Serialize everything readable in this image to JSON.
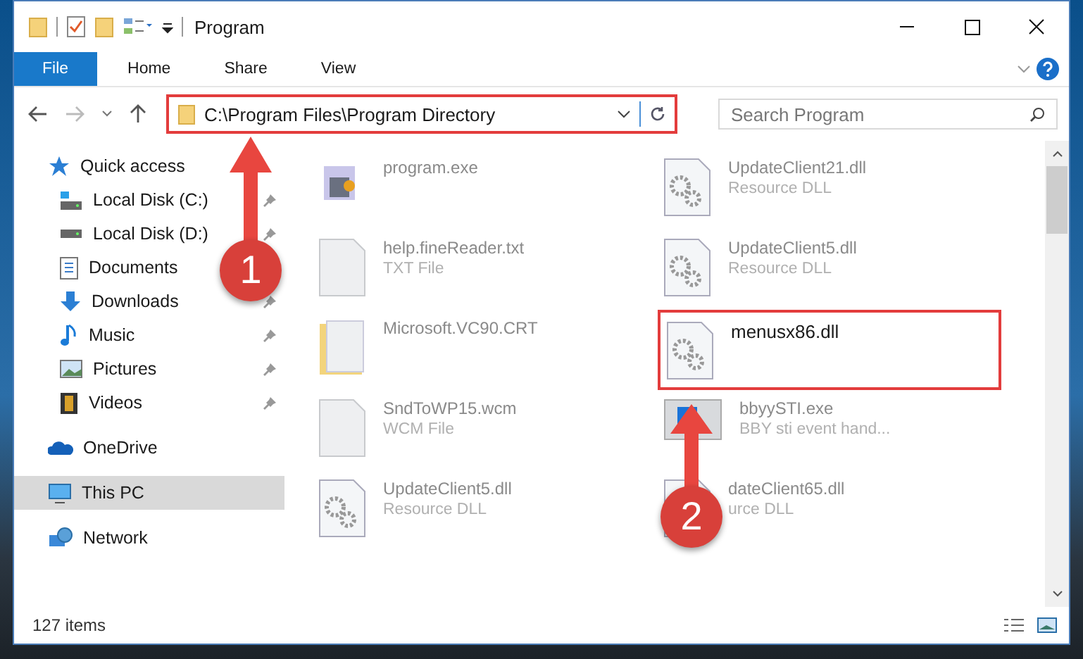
{
  "window": {
    "title": "Program"
  },
  "ribbon_tabs": [
    {
      "label": "File",
      "selected": true
    },
    {
      "label": "Home",
      "selected": false
    },
    {
      "label": "Share",
      "selected": false
    },
    {
      "label": "View",
      "selected": false
    }
  ],
  "address": {
    "path": "C:\\Program Files\\Program Directory",
    "highlighted": true
  },
  "search": {
    "placeholder": "Search Program"
  },
  "sidebar": {
    "items": [
      {
        "label": "Quick access",
        "kind": "star",
        "selected": false,
        "children": [
          {
            "label": "Local Disk (C:)",
            "kind": "disk-c",
            "pinned": true
          },
          {
            "label": "Local Disk (D:)",
            "kind": "disk",
            "pinned": true
          },
          {
            "label": "Documents",
            "kind": "docs"
          },
          {
            "label": "Downloads",
            "kind": "down",
            "pinned": true
          },
          {
            "label": "Music",
            "kind": "music",
            "pinned": true
          },
          {
            "label": "Pictures",
            "kind": "pics",
            "pinned": true
          },
          {
            "label": "Videos",
            "kind": "video",
            "pinned": true
          }
        ]
      },
      {
        "label": "OneDrive",
        "kind": "cloud",
        "selected": false
      },
      {
        "label": "This PC",
        "kind": "pc",
        "selected": true
      },
      {
        "label": "Network",
        "kind": "net",
        "selected": false
      }
    ]
  },
  "files": [
    {
      "name": "program.exe",
      "kind": "exe",
      "highlighted": false
    },
    {
      "name": "UpdateClient21.dll",
      "type": "Resource DLL",
      "kind": "dll",
      "highlighted": false
    },
    {
      "name": "help.fineReader.txt",
      "type": "TXT File",
      "kind": "txt",
      "highlighted": false
    },
    {
      "name": "UpdateClient5.dll",
      "type": "Resource DLL",
      "kind": "dll",
      "highlighted": false
    },
    {
      "name": "Microsoft.VC90.CRT",
      "kind": "folder",
      "highlighted": false
    },
    {
      "name": "menusx86.dll",
      "kind": "dll",
      "highlighted": true
    },
    {
      "name": "SndToWP15.wcm",
      "type": "WCM File",
      "kind": "txt",
      "highlighted": false
    },
    {
      "name": "bbyySTI.exe",
      "type": "BBY sti event hand...",
      "kind": "app",
      "highlighted": false
    },
    {
      "name": "UpdateClient5.dll",
      "type": "Resource DLL",
      "kind": "dll",
      "highlighted": false
    },
    {
      "name": "dateClient65.dll",
      "type": "urce DLL",
      "kind": "dll",
      "highlighted": false
    }
  ],
  "status_bar": {
    "count": "127 items"
  },
  "annotations": [
    {
      "number": "1"
    },
    {
      "number": "2"
    }
  ]
}
